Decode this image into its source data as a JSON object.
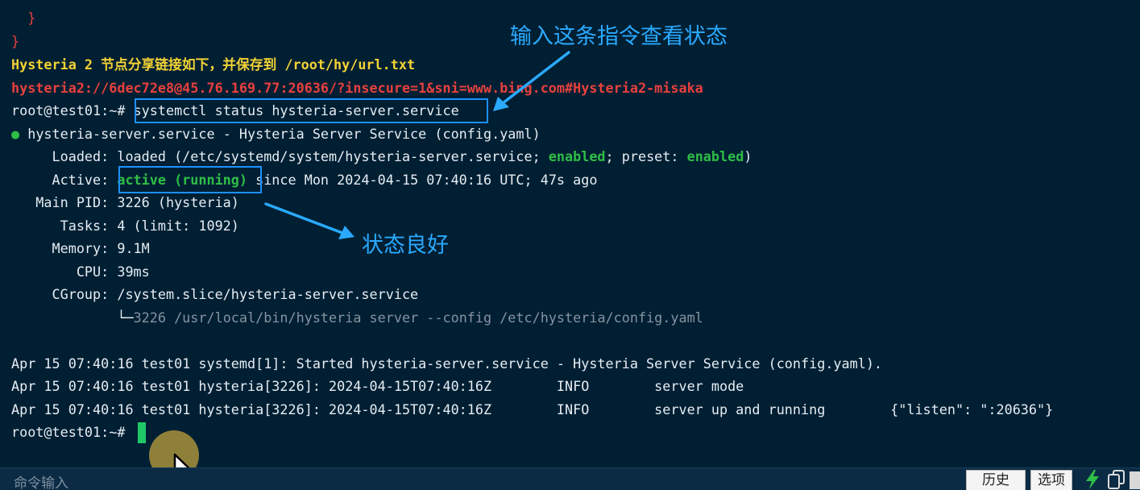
{
  "terminal": {
    "lines": {
      "brace_inner": "  }",
      "brace_outer": "}",
      "share_notice": "Hysteria 2 节点分享链接如下，并保存到 /root/hy/url.txt",
      "share_link": "hysteria2://6dec72e8@45.76.169.77:20636/?insecure=1&sni=www.bing.com#Hysteria2-misaka",
      "prompt1": "root@test01:~# ",
      "command1": "systemctl status hysteria-server.service",
      "service_bullet": "●",
      "service_title": " hysteria-server.service - Hysteria Server Service (config.yaml)",
      "loaded_label": "     Loaded: ",
      "loaded_value_a": "loaded (/etc/systemd/system/hysteria-server.service; ",
      "loaded_enabled": "enabled",
      "loaded_value_b": "; preset: ",
      "loaded_preset": "enabled",
      "loaded_value_c": ")",
      "active_label": "     Active: ",
      "active_value": "active (running)",
      "active_since": " since Mon 2024-04-15 07:40:16 UTC; 47s ago",
      "pid_line": "   Main PID: 3226 (hysteria)",
      "tasks_line": "      Tasks: 4 (limit: 1092)",
      "memory_line": "     Memory: 9.1M",
      "cpu_line": "        CPU: 39ms",
      "cgroup_line": "     CGroup: /system.slice/hysteria-server.service",
      "cgroup_tree_prefix": "             └─",
      "cgroup_tree_value": "3226 /usr/local/bin/hysteria server --config /etc/hysteria/config.yaml",
      "log1": "Apr 15 07:40:16 test01 systemd[1]: Started hysteria-server.service - Hysteria Server Service (config.yaml).",
      "log2": "Apr 15 07:40:16 test01 hysteria[3226]: 2024-04-15T07:40:16Z        INFO        server mode",
      "log3": "Apr 15 07:40:16 test01 hysteria[3226]: 2024-04-15T07:40:16Z        INFO        server up and running        {\"listen\": \":20636\"}",
      "prompt2": "root@test01:~# "
    }
  },
  "annotations": {
    "command_note": "输入这条指令查看状态",
    "status_note": "状态良好"
  },
  "command_bar": {
    "placeholder": "命令输入",
    "history_button": "历史",
    "options_button": "选项"
  },
  "colors": {
    "background": "#001f33",
    "annotation": "#2aa9ff",
    "highlight_box": "#1e90ff",
    "status_green": "#2fbe46",
    "error_red": "#e8403d",
    "notice_yellow": "#f2d234"
  },
  "icons": [
    "bolt-icon",
    "copy-icon",
    "mouse-pointer-icon"
  ]
}
